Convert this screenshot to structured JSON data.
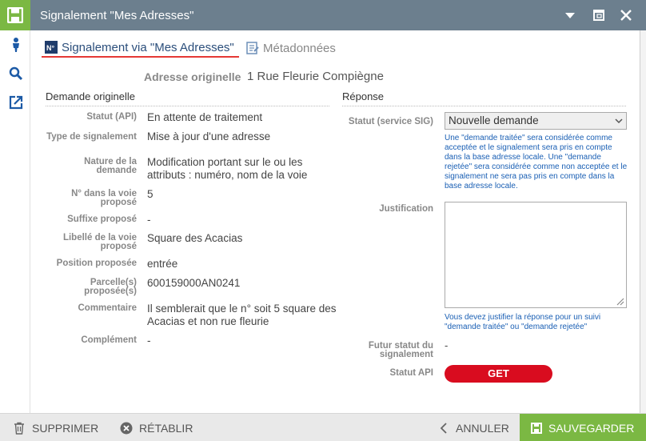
{
  "window": {
    "title": "Signalement \"Mes Adresses\""
  },
  "tabs": [
    {
      "label": "Signalement via \"Mes Adresses\"",
      "active": true
    },
    {
      "label": "Métadonnées",
      "active": false
    }
  ],
  "address": {
    "label": "Adresse originelle",
    "value": "1 Rue Fleurie Compiègne"
  },
  "demande": {
    "title": "Demande originelle",
    "fields": [
      {
        "label": "Statut (API)",
        "value": "En attente de traitement"
      },
      {
        "label": "Type de signalement",
        "value": "Mise à jour d'une adresse"
      },
      {
        "label": "Nature de la demande",
        "value": "Modification portant sur le ou les attributs : numéro, nom de la voie"
      },
      {
        "label": "N° dans la voie proposé",
        "value": "5"
      },
      {
        "label": "Suffixe proposé",
        "value": "-"
      },
      {
        "label": "Libellé de la voie proposé",
        "value": "Square des Acacias"
      },
      {
        "label": "Position proposée",
        "value": "entrée"
      },
      {
        "label": "Parcelle(s) proposée(s)",
        "value": "600159000AN0241"
      },
      {
        "label": "Commentaire",
        "value": "Il semblerait que le n° soit 5 square des Acacias et non rue fleurie"
      },
      {
        "label": "Complément",
        "value": "-"
      }
    ]
  },
  "reponse": {
    "title": "Réponse",
    "statut_label": "Statut (service SIG)",
    "statut_value": "Nouvelle demande",
    "statut_help": "Une \"demande traitée\" sera considérée comme acceptée et le signalement sera pris en compte dans la base adresse locale. Une \"demande rejetée\" sera considérée comme non acceptée et le signalement ne sera pas pris en compte dans la base adresse locale.",
    "justification_label": "Justification",
    "justification_value": "",
    "justification_help": "Vous devez justifier la réponse pour un suivi \"demande traitée\" ou \"demande rejetée\"",
    "futur_label": "Futur statut du signalement",
    "futur_value": "-",
    "api_label": "Statut API",
    "api_button": "GET"
  },
  "footer": {
    "delete": "SUPPRIMER",
    "restore": "RÉTABLIR",
    "cancel": "ANNULER",
    "save": "SAUVEGARDER"
  },
  "icons": {
    "app": "save-icon",
    "left": [
      "person-icon",
      "search-icon",
      "external-link-icon"
    ],
    "window": [
      "chevron-down-icon",
      "maximize-icon",
      "close-icon"
    ]
  },
  "colors": {
    "titlebar": "#6c7f8e",
    "accent_green": "#7bb843",
    "get_red": "#d90c1f",
    "tab_underline": "#e53935",
    "help_blue": "#1a5fb4"
  }
}
